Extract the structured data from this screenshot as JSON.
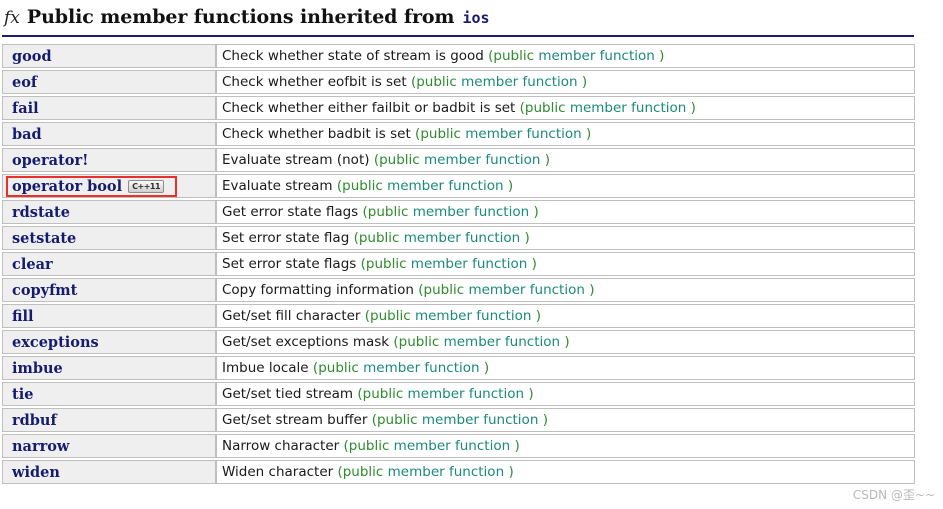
{
  "header": {
    "icon": "fx-icon",
    "icon_text": "fx",
    "title": "Public member functions inherited from",
    "scope": "ios"
  },
  "colors": {
    "name_text": "#151b6e",
    "name_bg": "#efefef",
    "paren_green": "#2e8b2e",
    "kind_teal": "#1a8a7a",
    "rule_navy": "#1b1f72",
    "annotation_red": "#e8312a",
    "cell_border": "#bfbfbf"
  },
  "table": {
    "kind_label": "member function",
    "paren_open": "(public",
    "paren_close": ")",
    "rows": [
      {
        "name": "good",
        "desc": "Check whether state of stream is good",
        "badge": null,
        "annotated": false
      },
      {
        "name": "eof",
        "desc": "Check whether eofbit is set",
        "badge": null,
        "annotated": false
      },
      {
        "name": "fail",
        "desc": "Check whether either failbit or badbit is set",
        "badge": null,
        "annotated": false
      },
      {
        "name": "bad",
        "desc": "Check whether badbit is set",
        "badge": null,
        "annotated": false
      },
      {
        "name": "operator!",
        "desc": "Evaluate stream (not)",
        "badge": null,
        "annotated": false
      },
      {
        "name": "operator bool",
        "desc": "Evaluate stream",
        "badge": "C++11",
        "annotated": true
      },
      {
        "name": "rdstate",
        "desc": "Get error state flags",
        "badge": null,
        "annotated": false
      },
      {
        "name": "setstate",
        "desc": "Set error state flag",
        "badge": null,
        "annotated": false
      },
      {
        "name": "clear",
        "desc": "Set error state flags",
        "badge": null,
        "annotated": false
      },
      {
        "name": "copyfmt",
        "desc": "Copy formatting information",
        "badge": null,
        "annotated": false
      },
      {
        "name": "fill",
        "desc": "Get/set fill character",
        "badge": null,
        "annotated": false
      },
      {
        "name": "exceptions",
        "desc": "Get/set exceptions mask",
        "badge": null,
        "annotated": false
      },
      {
        "name": "imbue",
        "desc": "Imbue locale",
        "badge": null,
        "annotated": false
      },
      {
        "name": "tie",
        "desc": "Get/set tied stream",
        "badge": null,
        "annotated": false
      },
      {
        "name": "rdbuf",
        "desc": "Get/set stream buffer",
        "badge": null,
        "annotated": false
      },
      {
        "name": "narrow",
        "desc": "Narrow character",
        "badge": null,
        "annotated": false
      },
      {
        "name": "widen",
        "desc": "Widen character",
        "badge": null,
        "annotated": false
      }
    ]
  },
  "watermark": {
    "text": "CSDN @歪~~"
  }
}
